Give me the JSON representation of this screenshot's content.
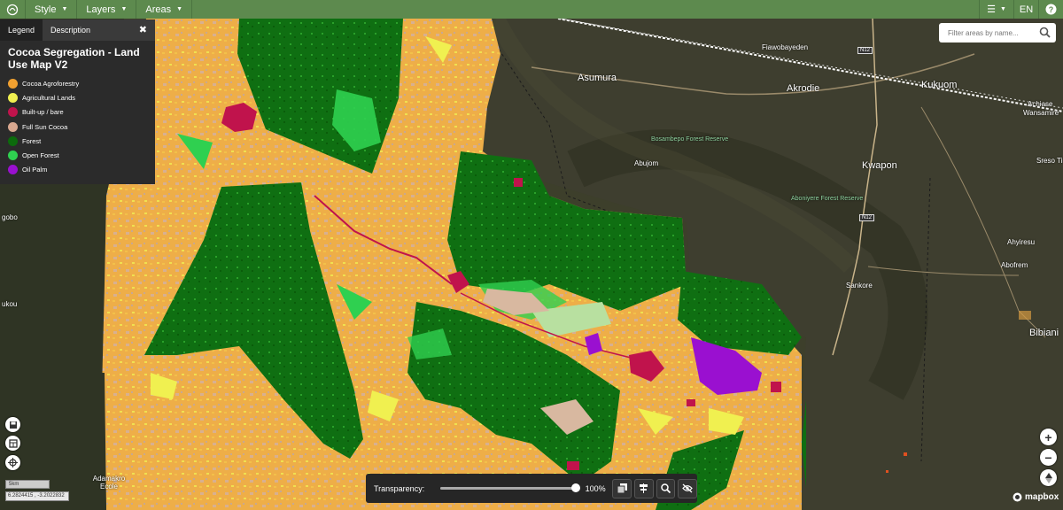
{
  "topbar": {
    "menus": [
      {
        "label": "Style"
      },
      {
        "label": "Layers"
      },
      {
        "label": "Areas"
      }
    ],
    "language": "EN"
  },
  "legend": {
    "tabs": [
      "Legend",
      "Description"
    ],
    "active_tab": "Legend",
    "title": "Cocoa Segregation - Land Use Map V2",
    "items": [
      {
        "label": "Cocoa Agroforestry",
        "color": "#f0a030"
      },
      {
        "label": "Agricultural Lands",
        "color": "#f0f050"
      },
      {
        "label": "Built-up / bare",
        "color": "#c0134c"
      },
      {
        "label": "Full Sun Cocoa",
        "color": "#d8a890"
      },
      {
        "label": "Forest",
        "color": "#0c6a0c"
      },
      {
        "label": "Open Forest",
        "color": "#2fd050"
      },
      {
        "label": "Oil Palm",
        "color": "#9a10d0"
      }
    ]
  },
  "search": {
    "placeholder": "Filter areas by name..."
  },
  "places": {
    "fiawobayeden": "Fiawobayeden",
    "asumura": "Asumura",
    "akrodie": "Akrodie",
    "kukuom": "Kukuom",
    "achiase": "Achiase",
    "wansamire": "Wansamire",
    "bosambepo": "Bosambepo Forest Reserve",
    "abujom": "Abujom",
    "kwapon": "Kwapon",
    "sreso": "Sreso Tim",
    "aboniyere": "Aboniyere Forest Reserve",
    "ahyiresu": "Ahyiresu",
    "abofrem": "Abofrem",
    "sankore": "Sankore",
    "bibiani": "Bibiani",
    "gobo": "gobo",
    "ukou": "ukou",
    "adamakro": "Adamakro Ecole",
    "n12a": "N12",
    "n12b": "N12"
  },
  "scale": {
    "label": "5km"
  },
  "coords": {
    "text": "6.2824415 , -3.2022832"
  },
  "transparency": {
    "label": "Transparency:",
    "value_text": "100%",
    "value": 1.0
  },
  "attribution": "mapbox"
}
